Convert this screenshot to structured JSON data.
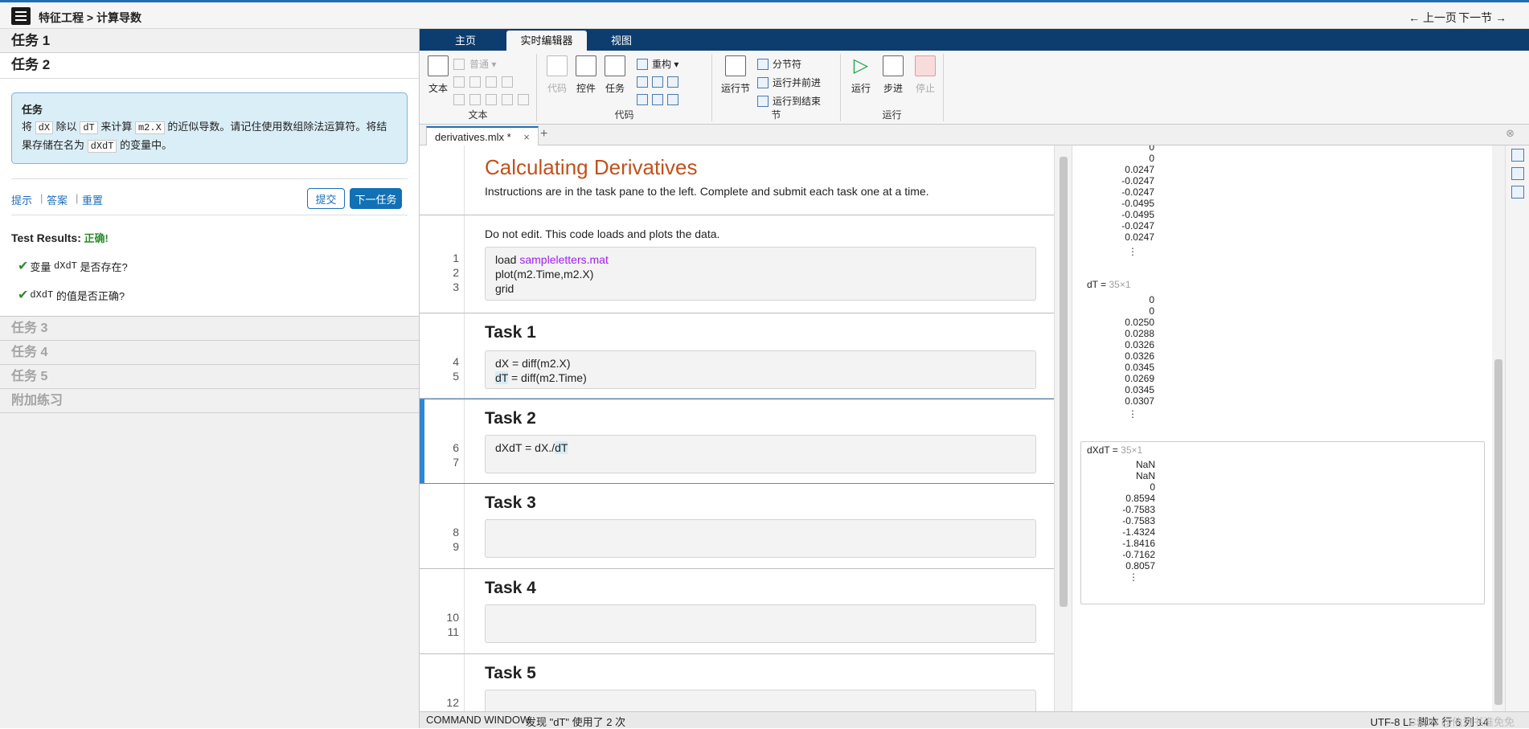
{
  "topbar": {
    "breadcrumb": "特征工程 > 计算导数",
    "prev_label": "← 上一页",
    "next_label": "下一节 →"
  },
  "tasks_panel": {
    "task1": "任务 1",
    "task2": "任务 2",
    "card_title": "任务",
    "instr_1": "将",
    "dx": "dX",
    "instr_2": "除以",
    "dt": "dT",
    "instr_3": "来计算",
    "m2x": "m2.X",
    "instr_4": "的近似导数。请记住使用数组除法运算符。将结果存储在名为",
    "dxdt": "dXdT",
    "instr_5": "的变量中。",
    "hint": "提示",
    "answer": "答案",
    "reset": "重置",
    "submit": "提交",
    "next_task": "下一任务",
    "results_label": "Test Results:",
    "results_value": "正确!",
    "check1_prefix": "变量",
    "check1_code": "dXdT",
    "check1_suffix": "是否存在?",
    "check2_code": "dXdT",
    "check2_suffix": "的值是否正确?",
    "task3": "任务 3",
    "task4": "任务 4",
    "task5": "任务 5",
    "extra": "附加练习"
  },
  "toolstrip": {
    "tabs": [
      "主页",
      "实时编辑器",
      "视图"
    ],
    "text_btn": "文本",
    "style_dropdown": "普通",
    "group_text": "文本",
    "code_btn": "代码",
    "control_btn": "控件",
    "task_btn": "任务",
    "refactor": "重构",
    "group_code": "代码",
    "run_section": "运行节",
    "section_break": "分节符",
    "run_advance": "运行并前进",
    "run_to_end": "运行到结束",
    "group_section": "节",
    "run": "运行",
    "step": "步进",
    "stop": "停止",
    "group_run": "运行"
  },
  "doc": {
    "tab_label": "derivatives.mlx *",
    "add_tab": "+",
    "close": "⊗"
  },
  "editor": {
    "title": "Calculating Derivatives",
    "subtitle": "Instructions are in the task pane to the left. Complete and submit each task one at a time.",
    "note": "Do not edit. This code loads and plots the data.",
    "ln1": "1",
    "ln2": "2",
    "ln3": "3",
    "ln4": "4",
    "ln5": "5",
    "ln6": "6",
    "ln7": "7",
    "ln8": "8",
    "ln9": "9",
    "ln10": "10",
    "ln11": "11",
    "ln12": "12",
    "code1_kw": "load ",
    "code1_str": "sampleletters.mat",
    "code2": "plot(m2.Time,m2.X)",
    "code3": "grid",
    "task1": "Task 1",
    "code4": "dX = diff(m2.X)",
    "code5_var": "dT",
    "code5_rest": " = diff(m2.Time)",
    "task2": "Task 2",
    "code6_a": "dXdT = dX./",
    "code6_var": "dT",
    "task3": "Task 3",
    "task4": "Task 4",
    "task5": "Task 5"
  },
  "output": {
    "dx_values": [
      "0",
      "0",
      "0.0247",
      "-0.0247",
      "-0.0247",
      "-0.0495",
      "-0.0495",
      "-0.0247",
      "0.0247"
    ],
    "dt_label": "dT = ",
    "dt_size": "35×1",
    "dt_values": [
      "0",
      "0",
      "0.0250",
      "0.0288",
      "0.0326",
      "0.0326",
      "0.0345",
      "0.0269",
      "0.0345",
      "0.0307"
    ],
    "dxdt_label": "dXdT = ",
    "dxdt_size": "35×1",
    "dxdt_values": [
      "NaN",
      "NaN",
      "0",
      "0.8594",
      "-0.7583",
      "-0.7583",
      "-1.4324",
      "-1.8416",
      "-0.7162",
      "0.8057"
    ],
    "ellipsis": "⋮"
  },
  "status": {
    "command_window": "COMMAND WINDOW",
    "message": "发现 \"dT\" 使用了 2 次",
    "right": "UTF-8   LF   脚本   行 6  列 14",
    "watermark": "CSDN @他为书淮免免"
  }
}
